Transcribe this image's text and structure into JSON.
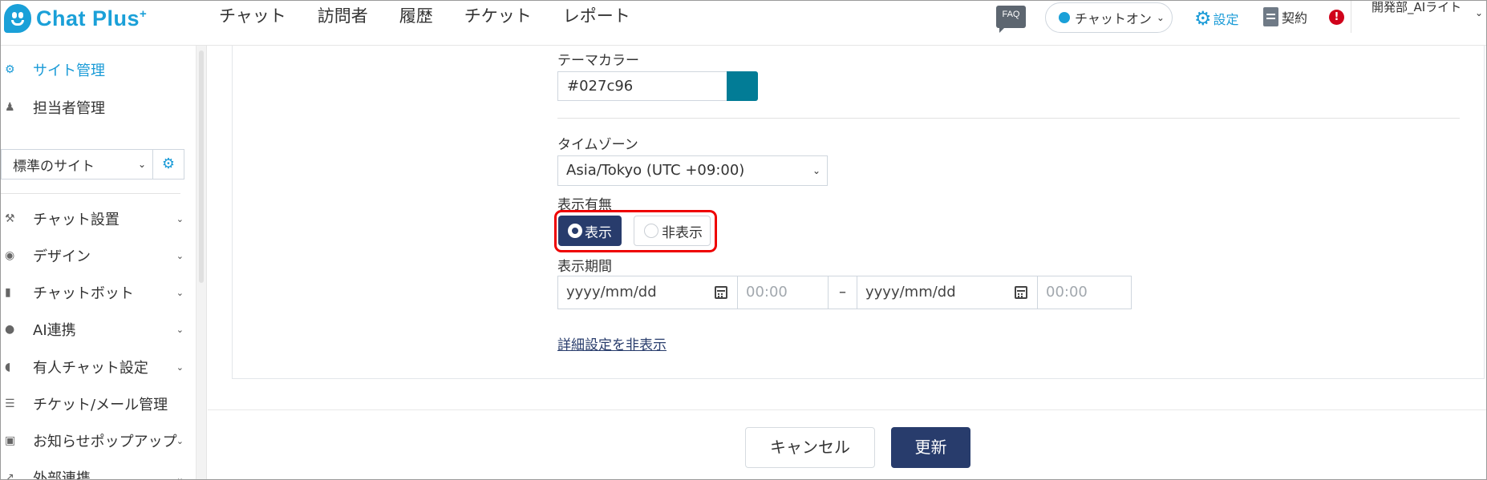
{
  "header": {
    "logo_text": "Chat Plus",
    "logo_plus": "+",
    "nav": [
      "チャット",
      "訪問者",
      "履歴",
      "チケット",
      "レポート"
    ],
    "faq": "FAQ",
    "status_label": "チャットオン",
    "settings_label": "設定",
    "contract_label": "契約",
    "alert": "!",
    "user_name": "開発部_AIライト"
  },
  "sidebar": {
    "top_items": [
      {
        "label": "サイト管理",
        "icon": "gear-icon"
      },
      {
        "label": "担当者管理",
        "icon": "user-gear-icon"
      }
    ],
    "site_select": "標準のサイト",
    "menu_items": [
      {
        "label": "チャット設置",
        "icon": "tools-icon"
      },
      {
        "label": "デザイン",
        "icon": "palette-icon"
      },
      {
        "label": "チャットボット",
        "icon": "chat-icon"
      },
      {
        "label": "AI連携",
        "icon": "bulb-icon"
      },
      {
        "label": "有人チャット設定",
        "icon": "headset-icon"
      },
      {
        "label": "チケット/メール管理",
        "icon": "list-icon"
      },
      {
        "label": "お知らせポップアップ",
        "icon": "popup-icon"
      },
      {
        "label": "外部連携",
        "icon": "share-icon"
      }
    ]
  },
  "form": {
    "theme_color_label": "テーマカラー",
    "theme_color_value": "#027c96",
    "timezone_label": "タイムゾーン",
    "timezone_value": "Asia/Tokyo (UTC +09:00)",
    "display_label": "表示有無",
    "radio_show": "表示",
    "radio_hide": "非表示",
    "radio_selected": "表示",
    "period_label": "表示期間",
    "date_placeholder": "yyyy/mm/dd",
    "time_placeholder": "00:00",
    "dash": "–",
    "detail_link": "詳細設定を非表示"
  },
  "footer": {
    "cancel": "キャンセル",
    "update": "更新"
  },
  "colors": {
    "accent": "#1a9bd7",
    "primary": "#283c6c",
    "theme_swatch": "#027c96",
    "highlight": "#ee0000"
  }
}
